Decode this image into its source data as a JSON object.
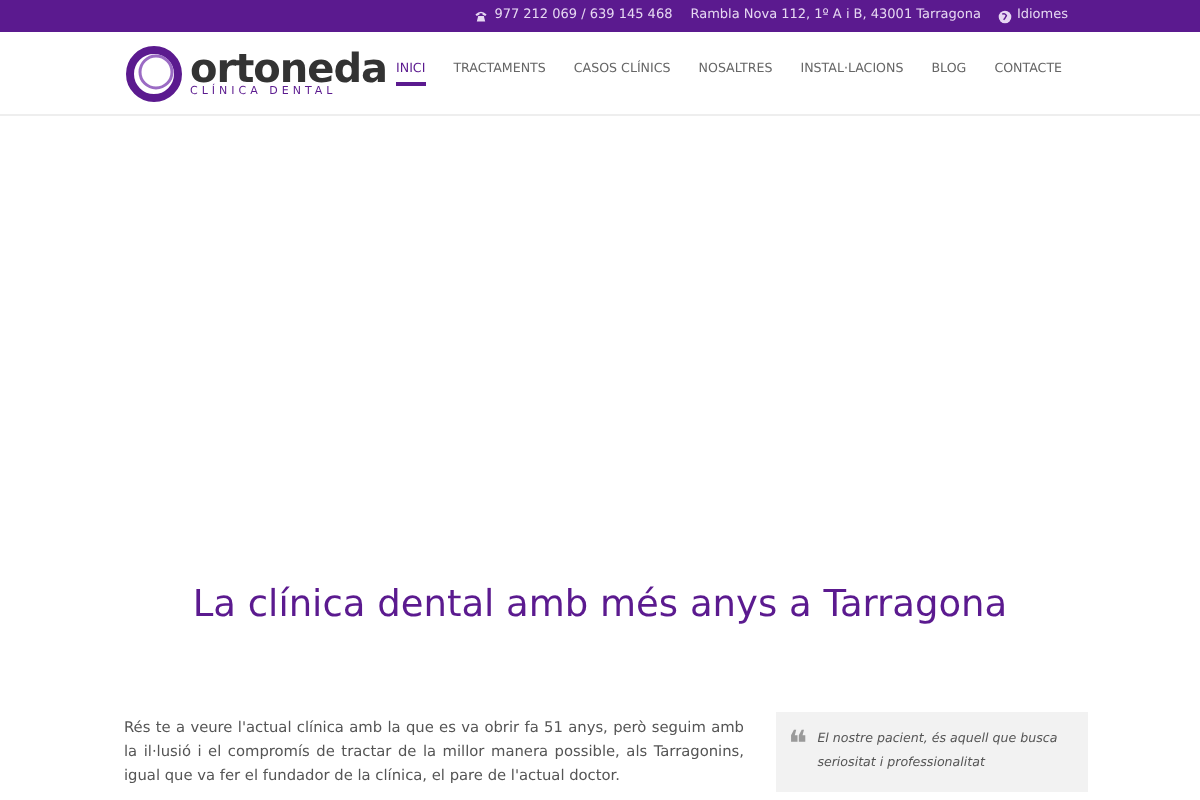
{
  "top_bar": {
    "phone": "977 212 069 / 639 145 468",
    "address": "Rambla Nova 112, 1º A i B, 43001 Tarragona",
    "language": "Idiomes"
  },
  "logo": {
    "name": "ortoneda",
    "tagline": "CLÍNICA DENTAL"
  },
  "nav": [
    {
      "label": "INICI",
      "selected": true
    },
    {
      "label": "TRACTAMENTS",
      "selected": false
    },
    {
      "label": "CASOS CLÍNICS",
      "selected": false
    },
    {
      "label": "NOSALTRES",
      "selected": false
    },
    {
      "label": "INSTAL·LACIONS",
      "selected": false
    },
    {
      "label": "BLOG",
      "selected": false
    },
    {
      "label": "CONTACTE",
      "selected": false
    }
  ],
  "heading": "La clínica dental amb més anys a Tarragona",
  "intro": "Rés te a veure l'actual clínica amb la que es va obrir fa 51 anys, però seguim amb la il·lusió i el compromís de tractar de la millor manera possible, als Tarragonins, igual que va fer el fundador de la clínica, el pare de l'actual doctor.",
  "quote": {
    "mark": "❝",
    "text": "El nostre pacient, és aquell que busca seriositat i professionalitat"
  }
}
